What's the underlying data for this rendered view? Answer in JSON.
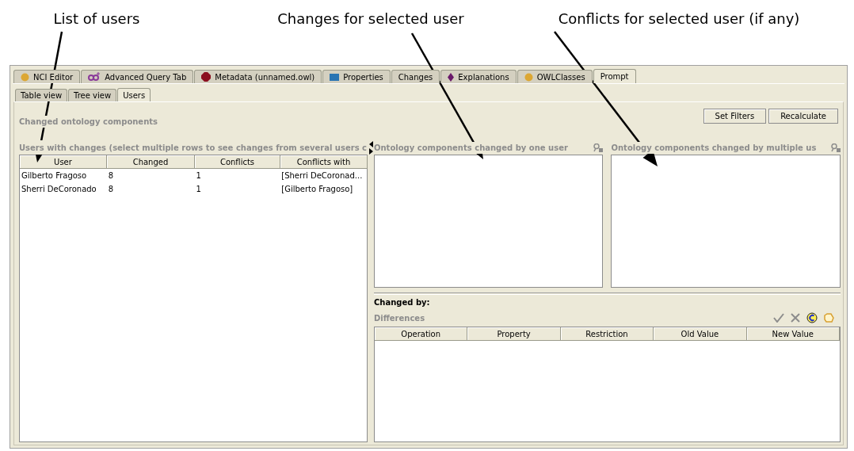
{
  "annotations": [
    {
      "label": "List of users"
    },
    {
      "label": "Changes for selected user"
    },
    {
      "label": "Conflicts for selected user (if any)"
    }
  ],
  "tabs": [
    {
      "label": "NCI Editor",
      "kind": "dot",
      "selected": false
    },
    {
      "label": "Advanced Query Tab",
      "kind": "query",
      "selected": false
    },
    {
      "label": "Metadata (unnamed.owl)",
      "kind": "hexagon",
      "selected": false
    },
    {
      "label": "Properties",
      "kind": "box",
      "selected": false
    },
    {
      "label": "Changes",
      "kind": "plain",
      "selected": false
    },
    {
      "label": "Explanations",
      "kind": "diamond",
      "selected": false
    },
    {
      "label": "OWLClasses",
      "kind": "dot",
      "selected": false
    },
    {
      "label": "Prompt",
      "kind": "plain",
      "selected": true
    }
  ],
  "view_tabs": [
    {
      "label": "Table view",
      "selected": false
    },
    {
      "label": "Tree view",
      "selected": false
    },
    {
      "label": "Users",
      "selected": true
    }
  ],
  "section_title": "Changed ontology components",
  "buttons": [
    "Set Filters",
    "Recalculate"
  ],
  "users_panel": {
    "title": "Users with changes (select multiple rows to see changes from several users c",
    "columns": [
      "User",
      "Changed",
      "Conflicts",
      "Conflicts with"
    ],
    "rows": [
      [
        "Gilberto Fragoso",
        "8",
        "1",
        "[Sherri DeCoronad..."
      ],
      [
        "Sherri DeCoronado",
        "8",
        "1",
        "[Gilberto Fragoso]"
      ]
    ]
  },
  "single_user_panel": {
    "title": "Ontology components changed by one user"
  },
  "multi_user_panel": {
    "title": "Ontology components changed by multiple us"
  },
  "changed_by": "Changed by:",
  "differences": {
    "title": "Differences",
    "columns": [
      "Operation",
      "Property",
      "Restriction",
      "Old Value",
      "New Value"
    ]
  }
}
